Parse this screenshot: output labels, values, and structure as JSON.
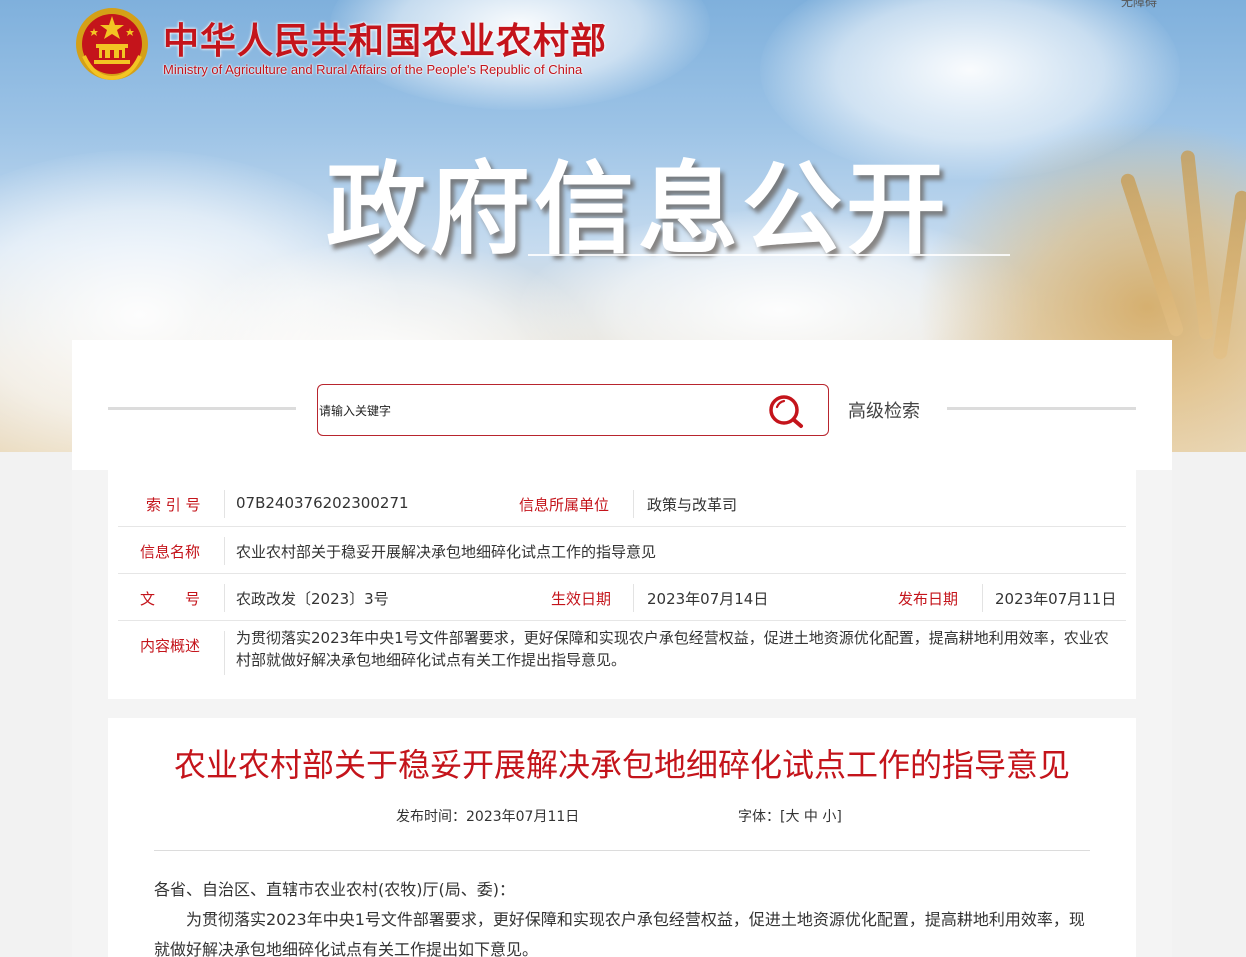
{
  "header": {
    "top_link": "无障碍",
    "site_title_cn": "中华人民共和国农业农村部",
    "site_title_en": "Ministry of Agriculture and Rural Affairs of the People's Republic of China",
    "hero_title": "政府信息公开"
  },
  "search": {
    "placeholder": "请输入关键字",
    "advanced_label": "高级检索"
  },
  "info": {
    "index_label": "索 引 号",
    "index_value": "07B240376202300271",
    "org_label": "信息所属单位",
    "org_value": "政策与改革司",
    "name_label": "信息名称",
    "name_value": "农业农村部关于稳妥开展解决承包地细碎化试点工作的指导意见",
    "doc_no_label": "文　　号",
    "doc_no_value": "农政改发〔2023〕3号",
    "effective_label": "生效日期",
    "effective_value": "2023年07月14日",
    "publish_label": "发布日期",
    "publish_value": "2023年07月11日",
    "summary_label": "内容概述",
    "summary_value": "为贯彻落实2023年中央1号文件部署要求，更好保障和实现农户承包经营权益，促进土地资源优化配置，提高耕地利用效率，农业农村部就做好解决承包地细碎化试点有关工作提出指导意见。"
  },
  "article": {
    "title": "农业农村部关于稳妥开展解决承包地细碎化试点工作的指导意见",
    "publish_time_label": "发布时间：",
    "publish_time_value": "2023年07月11日",
    "font_label": "字体：",
    "font_bracket_open": "[",
    "font_large": "大",
    "font_medium": "中",
    "font_small": "小",
    "font_bracket_close": "]",
    "salutation": "各省、自治区、直辖市农业农村(农牧)厅(局、委)：",
    "paragraph1": "为贯彻落实2023年中央1号文件部署要求，更好保障和实现农户承包经营权益，促进土地资源优化配置，提高耕地利用效率，现就做好解决承包地细碎化试点有关工作提出如下意见。"
  },
  "colors": {
    "brand_red": "#c4141b",
    "border_red": "#b8252e",
    "page_bg": "#f2f2f2"
  },
  "icons": [
    "national-emblem-icon",
    "search-icon"
  ]
}
